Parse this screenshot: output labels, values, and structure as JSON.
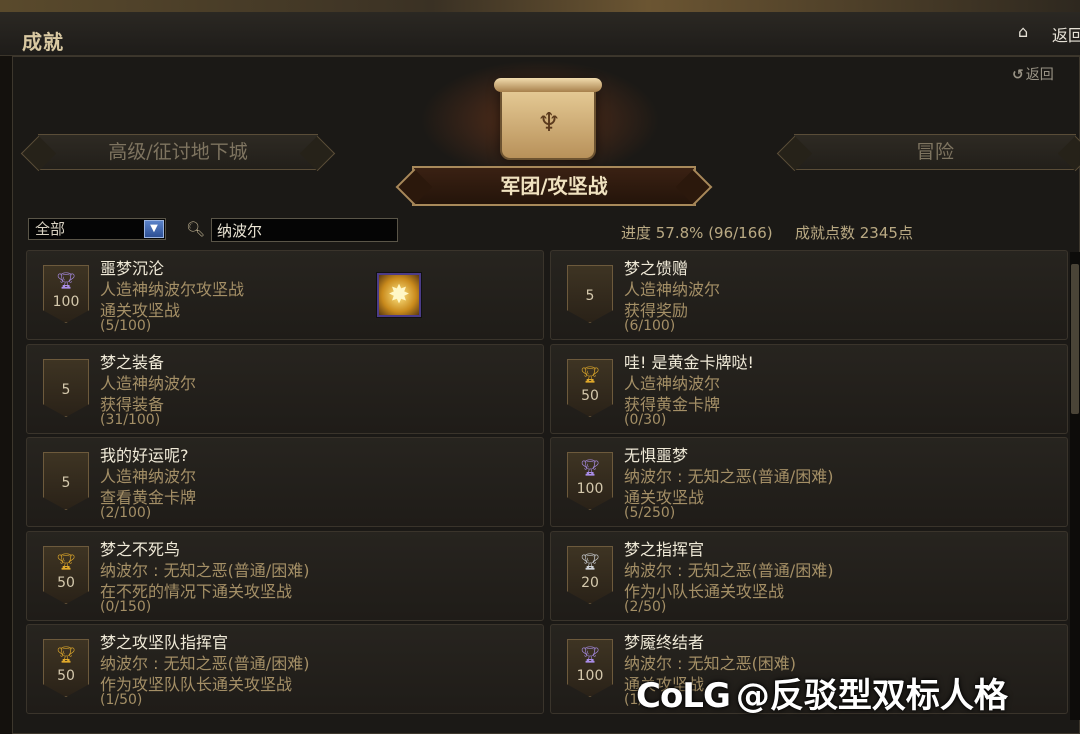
{
  "window": {
    "title": "成就",
    "home_icon": "home-icon",
    "back_label": "返回"
  },
  "header": {
    "back_label": "返回"
  },
  "categories": {
    "left": "高级/征讨地下城",
    "center": "军团/攻坚战",
    "right": "冒险"
  },
  "filter": {
    "selected": "全部"
  },
  "search": {
    "value": "纳波尔"
  },
  "stats": {
    "progress": "进度 57.8% (96/166)",
    "points": "成就点数 2345点"
  },
  "achievements": [
    {
      "title": "噩梦沉沦",
      "line1": "人造神纳波尔攻坚战",
      "line2": "通关攻坚战",
      "progress": "(5/100)",
      "points": "100",
      "trophy": "purple"
    },
    {
      "title": "梦之馈赠",
      "line1": "人造神纳波尔",
      "line2": "获得奖励",
      "progress": "(6/100)",
      "points": "5",
      "trophy": "none"
    },
    {
      "title": "梦之装备",
      "line1": "人造神纳波尔",
      "line2": "获得装备",
      "progress": "(31/100)",
      "points": "5",
      "trophy": "none"
    },
    {
      "title": "哇! 是黄金卡牌哒!",
      "line1": "人造神纳波尔",
      "line2": "获得黄金卡牌",
      "progress": "(0/30)",
      "points": "50",
      "trophy": "gold"
    },
    {
      "title": "我的好运呢?",
      "line1": "人造神纳波尔",
      "line2": "查看黄金卡牌",
      "progress": "(2/100)",
      "points": "5",
      "trophy": "none"
    },
    {
      "title": "无惧噩梦",
      "line1": "纳波尔 : 无知之恶(普通/困难)",
      "line2": "通关攻坚战",
      "progress": "(5/250)",
      "points": "100",
      "trophy": "purple"
    },
    {
      "title": "梦之不死鸟",
      "line1": "纳波尔 : 无知之恶(普通/困难)",
      "line2": "在不死的情况下通关攻坚战",
      "progress": "(0/150)",
      "points": "50",
      "trophy": "gold"
    },
    {
      "title": "梦之指挥官",
      "line1": "纳波尔 : 无知之恶(普通/困难)",
      "line2": "作为小队长通关攻坚战",
      "progress": "(2/50)",
      "points": "20",
      "trophy": "silver"
    },
    {
      "title": "梦之攻坚队指挥官",
      "line1": "纳波尔 : 无知之恶(普通/困难)",
      "line2": "作为攻坚队队长通关攻坚战",
      "progress": "(1/50)",
      "points": "50",
      "trophy": "gold"
    },
    {
      "title": "梦魇终结者",
      "line1": "纳波尔 : 无知之恶(困难)",
      "line2": "通关攻坚战",
      "progress": "(1/",
      "points": "100",
      "trophy": "purple"
    }
  ],
  "colors": {
    "gold": "#e0a92a",
    "silver": "#cfd3d8",
    "purple": "#a98de8"
  },
  "watermark": {
    "logo": "CoLG",
    "text": "@反驳型双标人格"
  }
}
